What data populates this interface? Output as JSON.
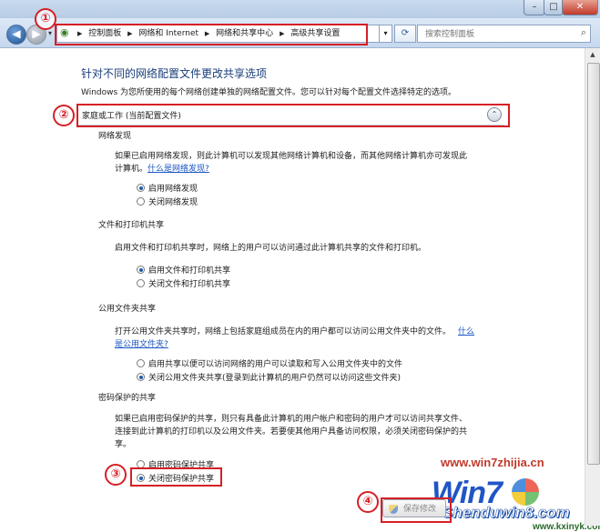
{
  "address_bar": {
    "breadcrumbs": [
      "控制面板",
      "网络和 Internet",
      "网络和共享中心",
      "高级共享设置"
    ]
  },
  "search": {
    "placeholder": "搜索控制面板"
  },
  "page": {
    "heading": "针对不同的网络配置文件更改共享选项",
    "intro": "Windows 为您所使用的每个网络创建单独的网络配置文件。您可以针对每个配置文件选择特定的选项。",
    "profile_label": "家庭或工作 (当前配置文件)"
  },
  "sections": {
    "discovery": {
      "title": "网络发现",
      "desc_line1": "如果已启用网络发现，则此计算机可以发现其他网络计算机和设备，而其他网络计算机亦可发现此",
      "desc_line2": "计算机。",
      "link": "什么是网络发现?",
      "options": [
        "启用网络发现",
        "关闭网络发现"
      ]
    },
    "printer_sharing": {
      "title": "文件和打印机共享",
      "desc": "启用文件和打印机共享时，网络上的用户可以访问通过此计算机共享的文件和打印机。",
      "options": [
        "启用文件和打印机共享",
        "关闭文件和打印机共享"
      ]
    },
    "public_folder": {
      "title": "公用文件夹共享",
      "desc_line1": "打开公用文件夹共享时，网络上包括家庭组成员在内的用户都可以访问公用文件夹中的文件。",
      "link_part1": "什么",
      "link_part2": "是公用文件夹?",
      "options": [
        "启用共享以便可以访问网络的用户可以读取和写入公用文件夹中的文件",
        "关闭公用文件夹共享(登录到此计算机的用户仍然可以访问这些文件夹)"
      ]
    },
    "password": {
      "title": "密码保护的共享",
      "desc_line1": "如果已启用密码保护的共享，则只有具备此计算机的用户帐户和密码的用户才可以访问共享文件、",
      "desc_line2": "连接到此计算机的打印机以及公用文件夹。若要使其他用户具备访问权限，必须关闭密码保护的共",
      "desc_line3": "享。",
      "options": [
        "启用密码保护共享",
        "关闭密码保护共享"
      ]
    }
  },
  "buttons": {
    "save": "保存修改"
  },
  "callouts": [
    "①",
    "②",
    "③",
    "④"
  ],
  "watermark": {
    "line1": "www.win7zhijia.cn",
    "logo": "Win7",
    "line2": "Shenduwin8.com",
    "line3": "www.kxinyk.com"
  }
}
